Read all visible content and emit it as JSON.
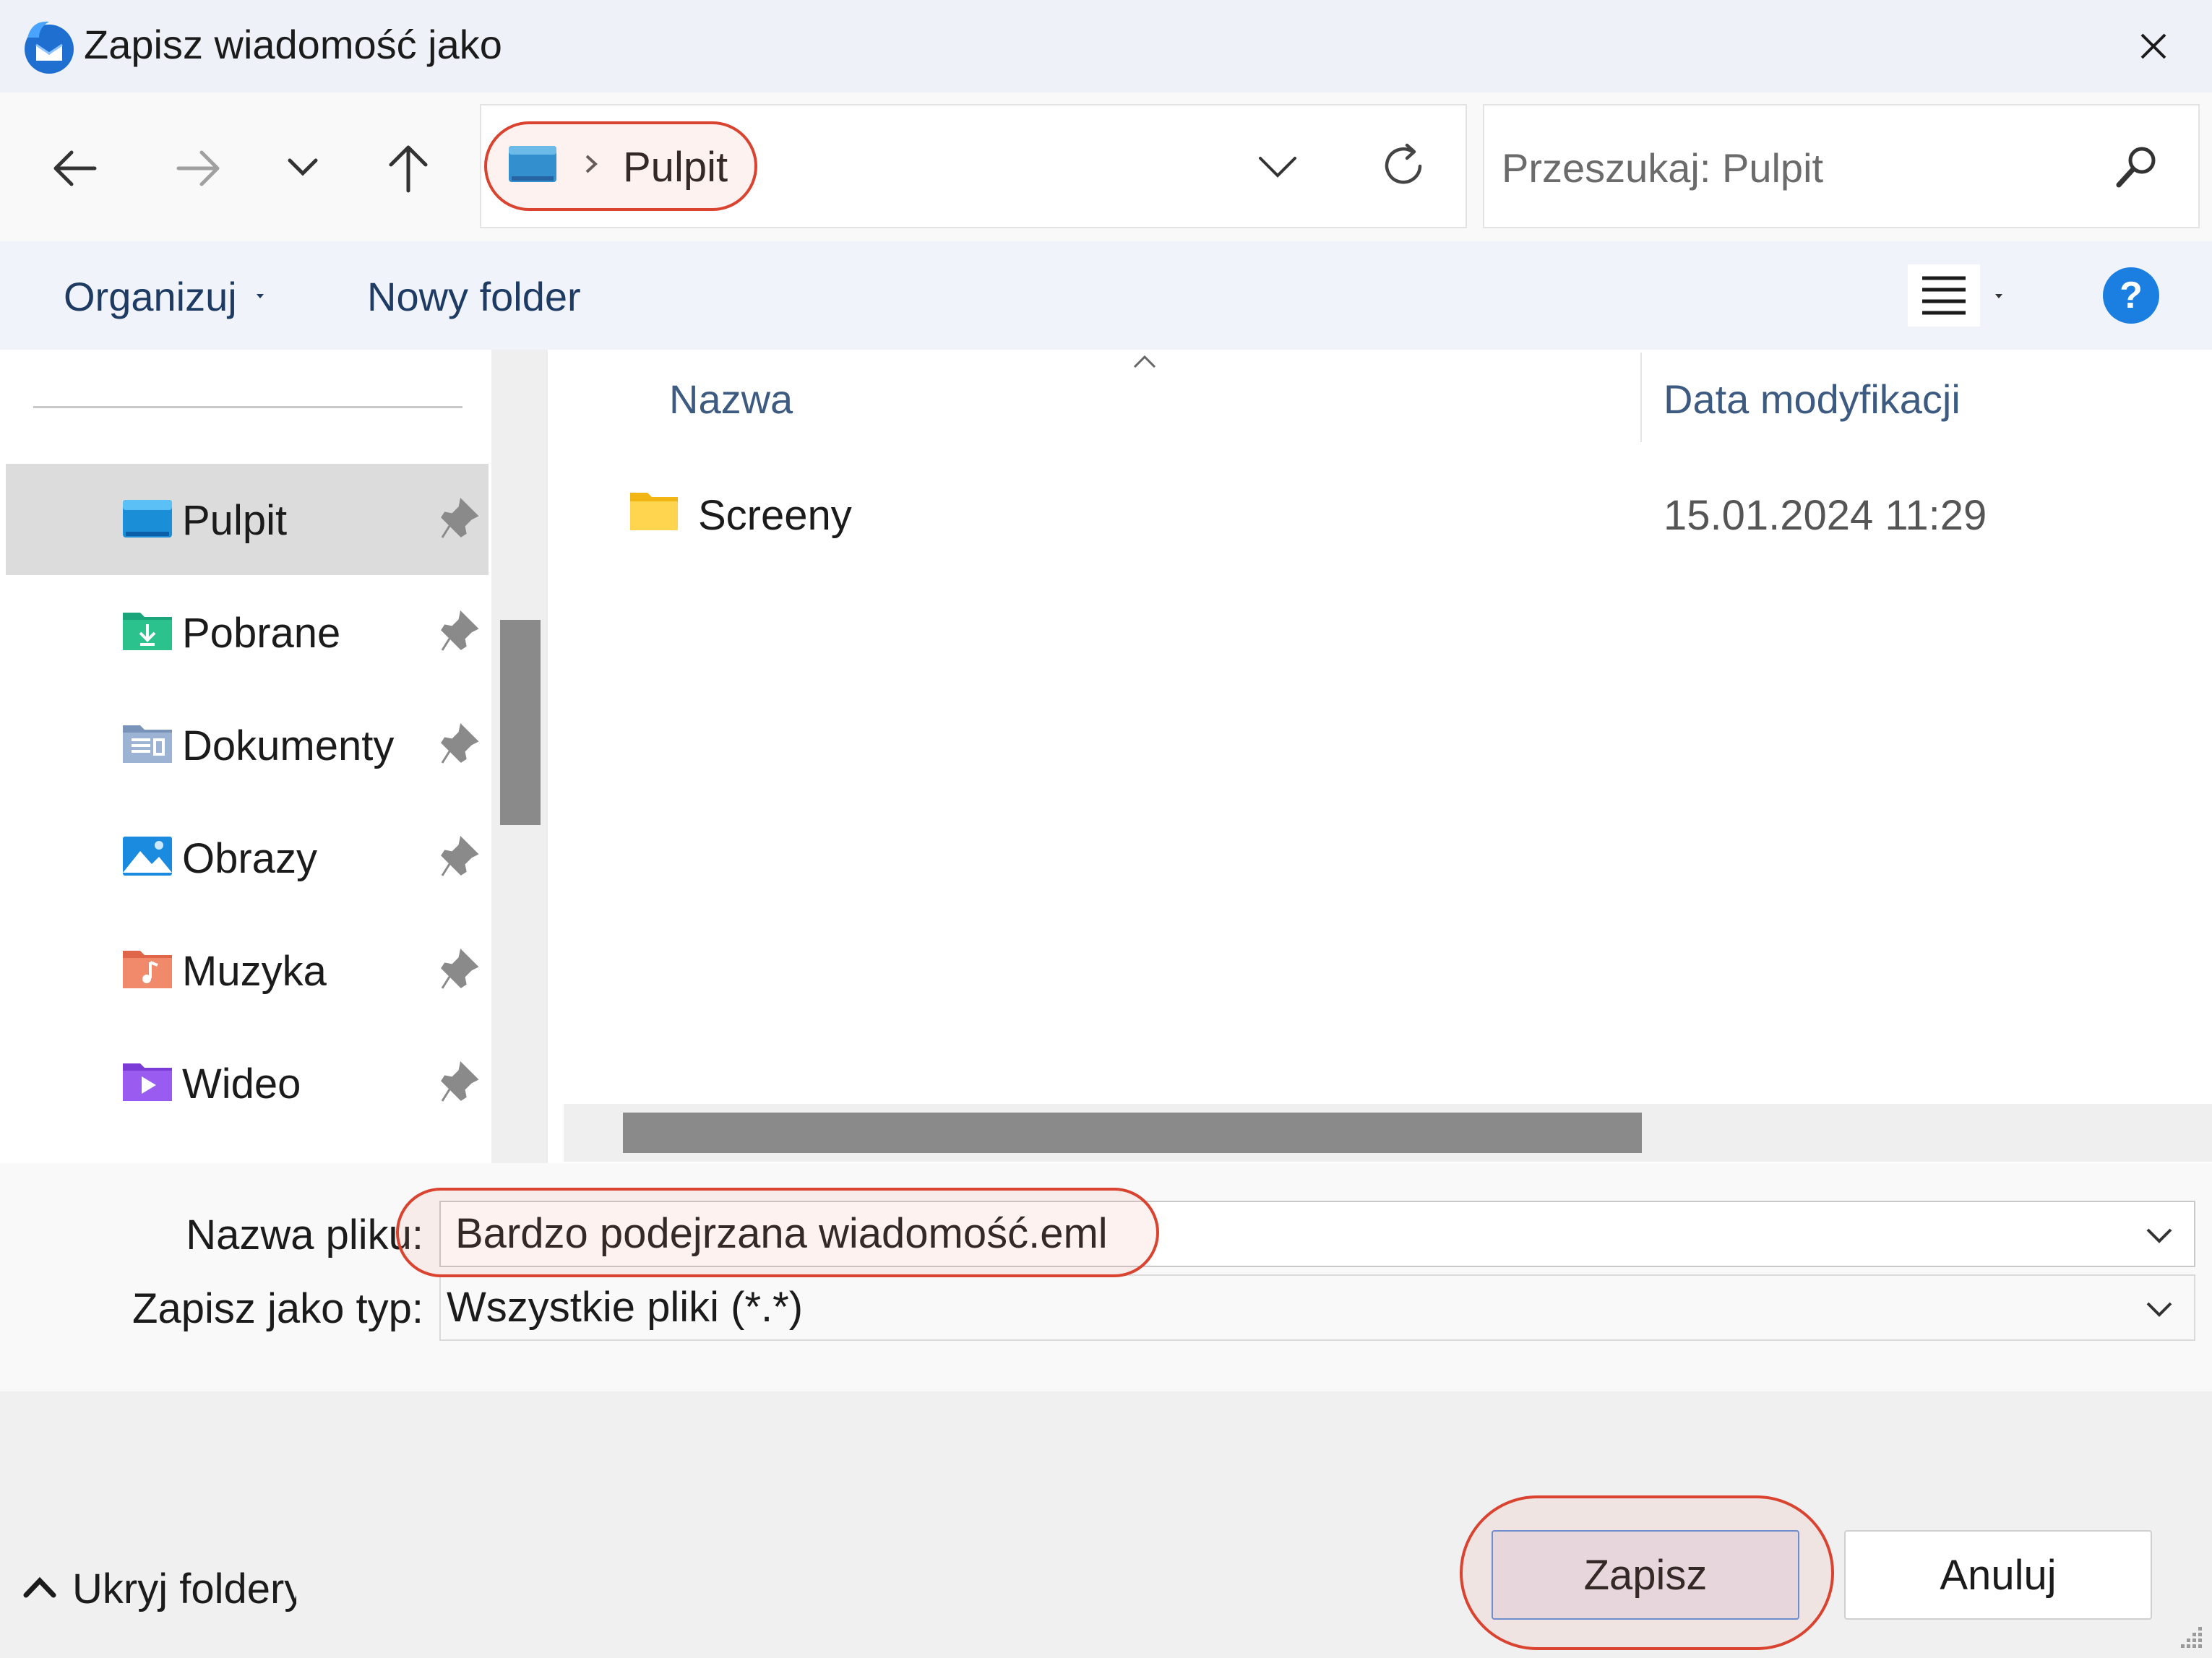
{
  "window": {
    "title": "Zapisz wiadomość jako",
    "app_icon": "thunderbird-icon",
    "close_icon": "close-icon"
  },
  "nav": {
    "back_icon": "arrow-left-icon",
    "forward_icon": "arrow-right-icon",
    "recent_icon": "chevron-down-icon",
    "up_icon": "arrow-up-icon",
    "breadcrumb_current": "Pulpit",
    "refresh_icon": "refresh-icon",
    "search_placeholder": "Przeszukaj: Pulpit",
    "search_icon": "search-icon"
  },
  "toolbar": {
    "organize_label": "Organizuj",
    "new_folder_label": "Nowy folder",
    "view_icon": "list-view-icon",
    "help_icon": "help-icon"
  },
  "sidebar": {
    "items": [
      {
        "label": "Pulpit",
        "icon": "desktop-icon",
        "selected": true,
        "pinned": true
      },
      {
        "label": "Pobrane",
        "icon": "downloads-icon",
        "selected": false,
        "pinned": true
      },
      {
        "label": "Dokumenty",
        "icon": "documents-icon",
        "selected": false,
        "pinned": true
      },
      {
        "label": "Obrazy",
        "icon": "pictures-icon",
        "selected": false,
        "pinned": true
      },
      {
        "label": "Muzyka",
        "icon": "music-icon",
        "selected": false,
        "pinned": true
      },
      {
        "label": "Wideo",
        "icon": "video-icon",
        "selected": false,
        "pinned": true
      }
    ]
  },
  "filelist": {
    "columns": [
      "Nazwa",
      "Data modyfikacji"
    ],
    "rows": [
      {
        "name": "Screeny",
        "date": "15.01.2024 11:29",
        "icon": "folder-icon"
      }
    ]
  },
  "form": {
    "filename_label": "Nazwa pliku:",
    "filename_value": "Bardzo podejrzana wiadomość.eml",
    "filetype_label": "Zapisz jako typ:",
    "filetype_value": "Wszystkie pliki (*.*)"
  },
  "footer": {
    "hide_folders_label": "Ukryj foldery",
    "save_label": "Zapisz",
    "cancel_label": "Anuluj"
  },
  "colors": {
    "highlight": "#d9432f",
    "accent": "#0f6cbd",
    "link_text": "#1e3b64"
  }
}
